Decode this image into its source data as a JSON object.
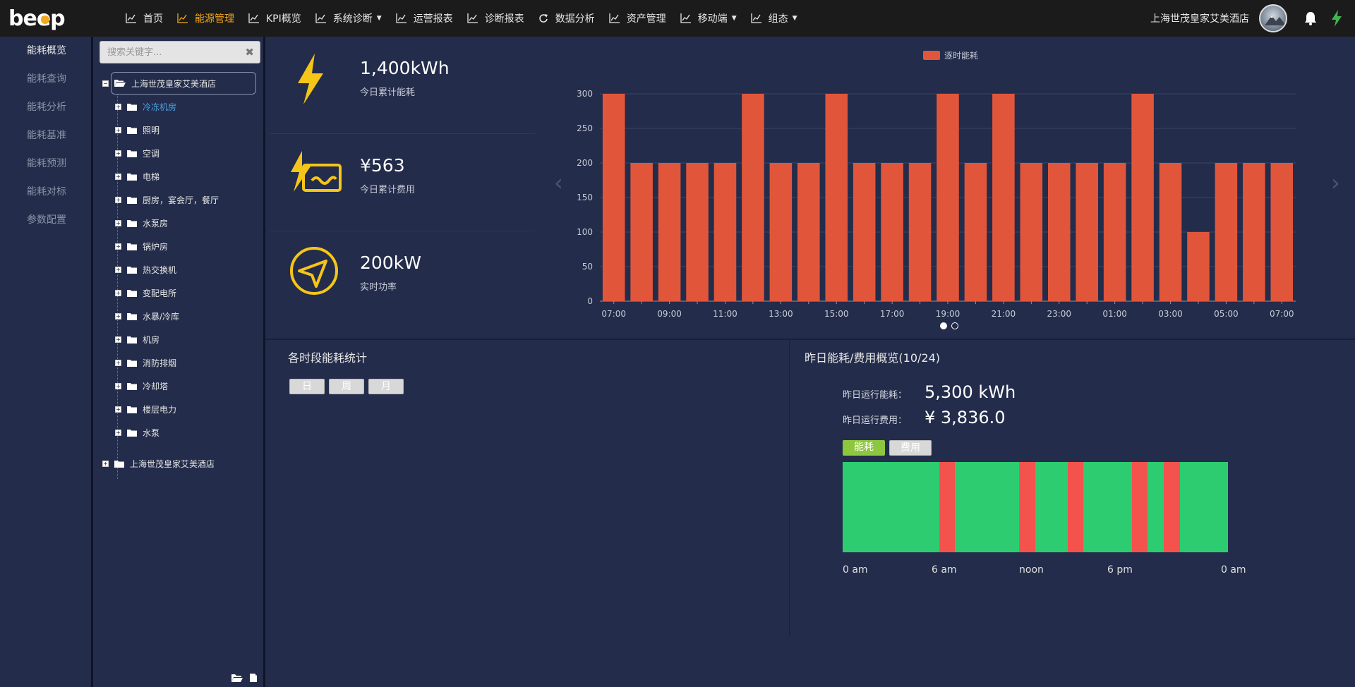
{
  "nav": {
    "logo_text": "beep",
    "items": [
      {
        "label": "首页",
        "active": false,
        "dropdown": false
      },
      {
        "label": "能源管理",
        "active": true,
        "dropdown": false
      },
      {
        "label": "KPI概览",
        "active": false,
        "dropdown": false
      },
      {
        "label": "系统诊断",
        "active": false,
        "dropdown": true
      },
      {
        "label": "运营报表",
        "active": false,
        "dropdown": false
      },
      {
        "label": "诊断报表",
        "active": false,
        "dropdown": false
      },
      {
        "label": "数据分析",
        "active": false,
        "dropdown": false
      },
      {
        "label": "资产管理",
        "active": false,
        "dropdown": false
      },
      {
        "label": "移动端",
        "active": false,
        "dropdown": true
      },
      {
        "label": "组态",
        "active": false,
        "dropdown": true
      }
    ],
    "hotel": "上海世茂皇家艾美酒店",
    "accent": "#f4a81d"
  },
  "leftmenu": [
    {
      "label": "能耗概览",
      "active": true
    },
    {
      "label": "能耗查询",
      "active": false
    },
    {
      "label": "能耗分析",
      "active": false
    },
    {
      "label": "能耗基准",
      "active": false
    },
    {
      "label": "能耗预测",
      "active": false
    },
    {
      "label": "能耗对标",
      "active": false
    },
    {
      "label": "参数配置",
      "active": false
    }
  ],
  "tree": {
    "search_placeholder": "搜索关键字...",
    "root": "上海世茂皇家艾美酒店",
    "children": [
      "冷冻机房",
      "照明",
      "空调",
      "电梯",
      "厨房，宴会厅，餐厅",
      "水泵房",
      "锅炉房",
      "热交换机",
      "变配电所",
      "水暴/冷库",
      "机房",
      "消防排烟",
      "冷却塔",
      "楼层电力",
      "水泵"
    ],
    "selected_index": 0,
    "root2": "上海世茂皇家艾美酒店"
  },
  "kpis": [
    {
      "value": "1,400kWh",
      "label": "今日累计能耗",
      "icon": "lightning-icon"
    },
    {
      "value": "¥563",
      "label": "今日累计费用",
      "icon": "power-card-icon"
    },
    {
      "value": "200kW",
      "label": "实时功率",
      "icon": "navigation-icon"
    }
  ],
  "chart_data": {
    "type": "bar",
    "legend": "逐时能耗",
    "legend_position": "top-center",
    "color": "#e1563a",
    "ylim": [
      0,
      300
    ],
    "yticks": [
      0,
      50,
      100,
      150,
      200,
      250,
      300
    ],
    "categories": [
      "07:00",
      "08:00",
      "09:00",
      "10:00",
      "11:00",
      "12:00",
      "13:00",
      "14:00",
      "15:00",
      "16:00",
      "17:00",
      "18:00",
      "19:00",
      "20:00",
      "21:00",
      "22:00",
      "23:00",
      "00:00",
      "01:00",
      "02:00",
      "03:00",
      "04:00",
      "05:00",
      "06:00",
      "07:00"
    ],
    "xtick_labels": [
      "07:00",
      "09:00",
      "11:00",
      "13:00",
      "15:00",
      "17:00",
      "19:00",
      "21:00",
      "23:00",
      "01:00",
      "03:00",
      "05:00",
      "07:00"
    ],
    "values": [
      300,
      200,
      200,
      200,
      200,
      300,
      200,
      200,
      300,
      200,
      200,
      200,
      300,
      200,
      300,
      200,
      200,
      200,
      200,
      300,
      200,
      100,
      200,
      200,
      200
    ],
    "grid": true
  },
  "period": {
    "title": "各时段能耗统计",
    "buttons": [
      "日",
      "周",
      "月"
    ]
  },
  "yesterday": {
    "title": "昨日能耗/费用概览(10/24)",
    "energy_label": "昨日运行能耗：",
    "energy_value": "5,300 kWh",
    "cost_label": "昨日运行费用：",
    "cost_value": "¥ 3,836.0",
    "tabs": [
      {
        "label": "能耗",
        "active": true
      },
      {
        "label": "费用",
        "active": false
      }
    ],
    "normal_color": "#2ecc71",
    "peak_color": "#f4524d",
    "peak_hours": [
      [
        6,
        7
      ],
      [
        11,
        12
      ],
      [
        14,
        15
      ],
      [
        18,
        19
      ],
      [
        20,
        21
      ]
    ],
    "axis_labels": [
      "0 am",
      "6 am",
      "noon",
      "6 pm",
      "0 am"
    ]
  }
}
